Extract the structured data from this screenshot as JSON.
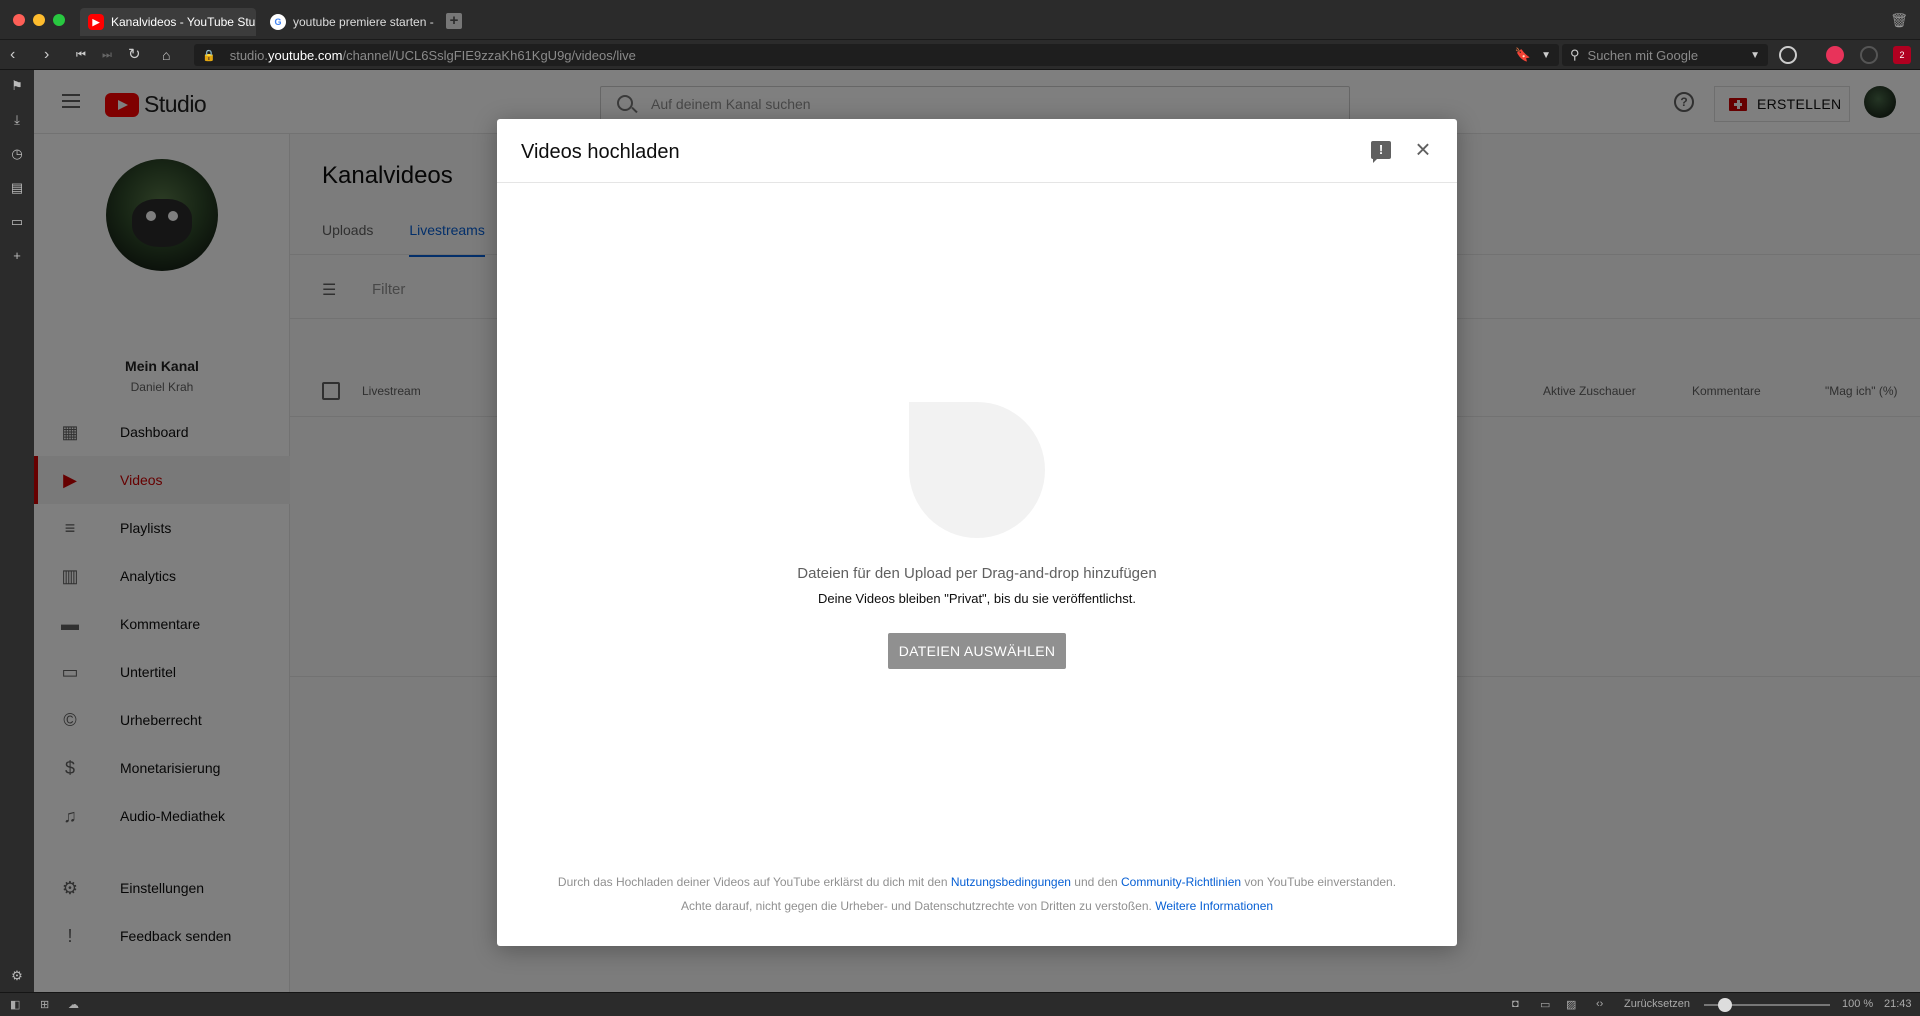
{
  "browser": {
    "tabs": [
      {
        "title": "Kanalvideos - YouTube Stu"
      },
      {
        "title": "youtube premiere starten -"
      }
    ],
    "url": {
      "prefix": "studio.",
      "host": "youtube.com",
      "path": "/channel/UCL6SslgFIE9zzaKh61KgU9g/videos/live"
    },
    "search_placeholder": "Suchen mit Google",
    "status": {
      "reset": "Zurücksetzen",
      "zoom": "100 %",
      "time": "21:43"
    },
    "extension_badge": "2"
  },
  "studio": {
    "logo_text": "Studio",
    "search_placeholder": "Auf deinem Kanal suchen",
    "create_label": "ERSTELLEN",
    "help_glyph": "?",
    "channel": {
      "name": "Mein Kanal",
      "owner": "Daniel Krah"
    },
    "nav": [
      {
        "label": "Dashboard",
        "icon": "dashboard-icon"
      },
      {
        "label": "Videos",
        "icon": "videos-icon",
        "active": true
      },
      {
        "label": "Playlists",
        "icon": "playlists-icon"
      },
      {
        "label": "Analytics",
        "icon": "analytics-icon"
      },
      {
        "label": "Kommentare",
        "icon": "comments-icon"
      },
      {
        "label": "Untertitel",
        "icon": "subtitles-icon"
      },
      {
        "label": "Urheberrecht",
        "icon": "copyright-icon"
      },
      {
        "label": "Monetarisierung",
        "icon": "dollar-icon"
      },
      {
        "label": "Audio-Mediathek",
        "icon": "audio-library-icon"
      }
    ],
    "bottom_nav": [
      {
        "label": "Einstellungen",
        "icon": "settings-icon"
      },
      {
        "label": "Feedback senden",
        "icon": "feedback-icon"
      }
    ],
    "main": {
      "title": "Kanalvideos",
      "tabs": [
        "Uploads",
        "Livestreams"
      ],
      "active_tab": "Livestreams",
      "filter_placeholder": "Filter",
      "columns": [
        "Livestream",
        "Aktive Zuschauer",
        "Kommentare",
        "\"Mag ich\" (%)"
      ]
    }
  },
  "dialog": {
    "title": "Videos hochladen",
    "feedback_glyph": "!",
    "close_glyph": "×",
    "drop_text": "Dateien für den Upload per Drag-and-drop hinzufügen",
    "drop_subtext": "Deine Videos bleiben \"Privat\", bis du sie veröffentlichst.",
    "select_button": "DATEIEN AUSWÄHLEN",
    "legal": {
      "line1_a": "Durch das Hochladen deiner Videos auf YouTube erklärst du dich mit den ",
      "terms_link": "Nutzungsbedingungen",
      "line1_b": " und den ",
      "guidelines_link": "Community-Richtlinien",
      "line1_c": " von YouTube einverstanden.",
      "line2": "Achte darauf, nicht gegen die Urheber- und Datenschutzrechte von Dritten zu verstoßen. ",
      "info_link": "Weitere Informationen"
    }
  },
  "colors": {
    "accent_red": "#cc0000",
    "link_blue": "#065fd4",
    "button_disabled": "#909090"
  }
}
